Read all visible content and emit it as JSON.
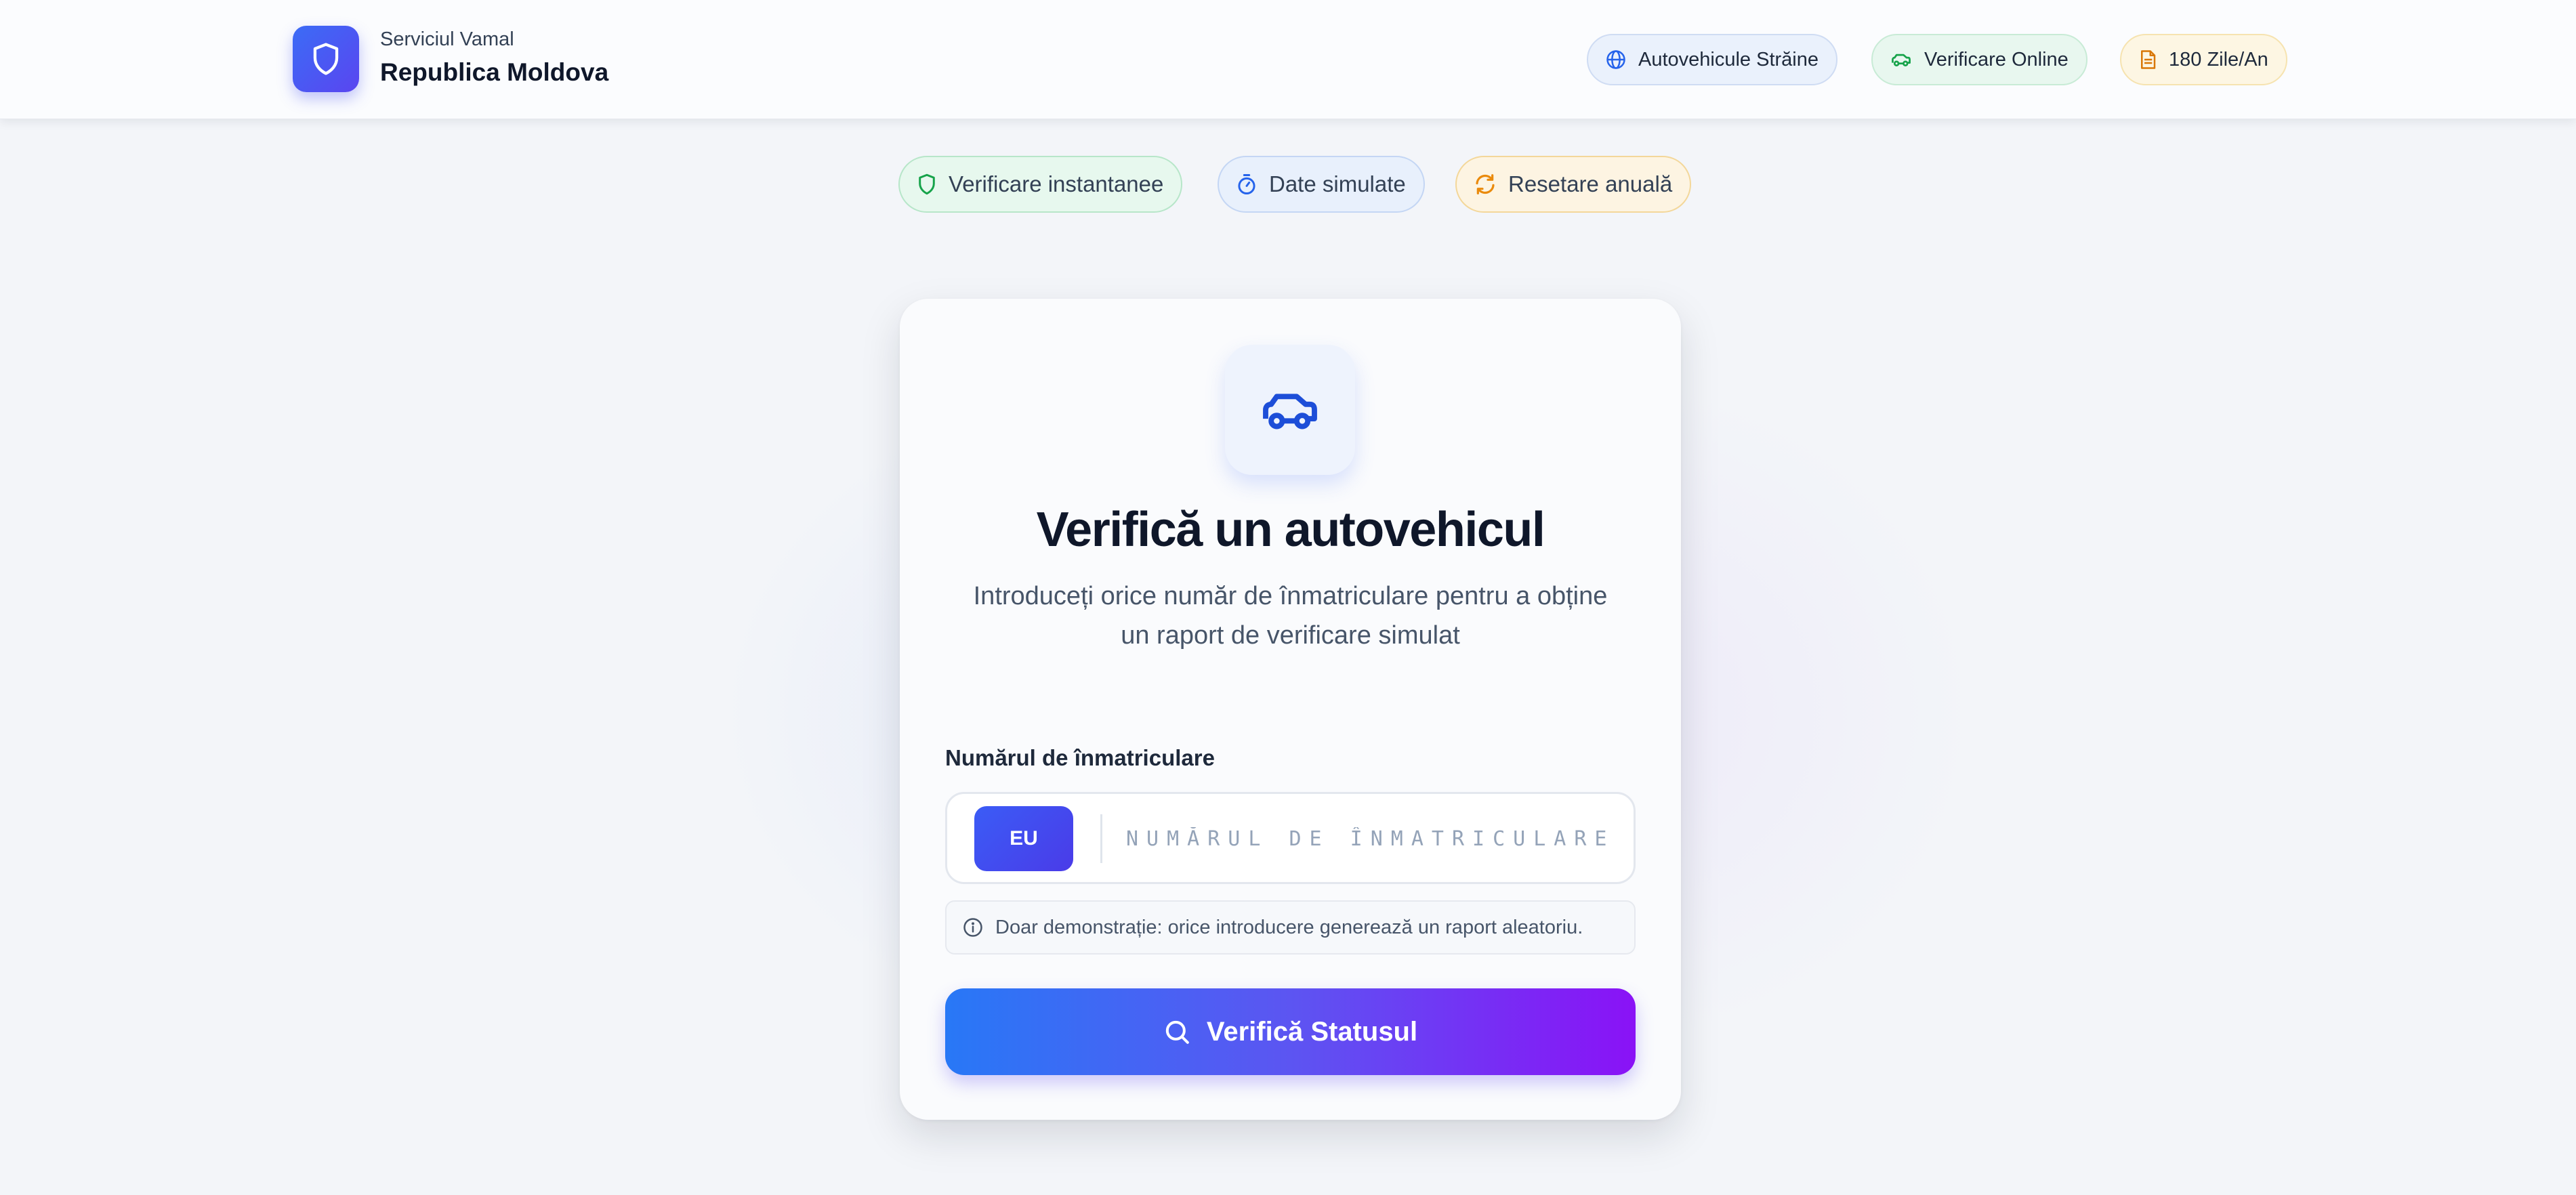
{
  "header": {
    "subtitle": "Serviciul Vamal",
    "title": "Republica Moldova",
    "pills": [
      {
        "label": "Autovehicule Străine",
        "icon": "globe-icon"
      },
      {
        "label": "Verificare Online",
        "icon": "car-icon"
      },
      {
        "label": "180 Zile/An",
        "icon": "document-icon"
      }
    ]
  },
  "features": [
    {
      "label": "Verificare instantanee",
      "icon": "shield-icon"
    },
    {
      "label": "Date simulate",
      "icon": "timer-icon"
    },
    {
      "label": "Resetare anuală",
      "icon": "refresh-icon"
    }
  ],
  "card": {
    "icon": "car-icon",
    "title": "Verifică un autovehicul",
    "description": "Introduceți orice număr de înmatriculare pentru a obține un raport de verificare simulat",
    "field_label": "Numărul de înmatriculare",
    "plate_badge": "EU",
    "plate_value": "",
    "plate_placeholder": "NUMĂRUL DE ÎNMATRICULARE",
    "note": "Doar demonstrație: orice introducere generează un raport aleatoriu.",
    "submit_label": "Verifică Statusul"
  },
  "colors": {
    "accent_blue": "#3b6cf6",
    "accent_purple": "#8a12f6",
    "success_green": "#16a34a",
    "warning_amber": "#f59e0b"
  }
}
